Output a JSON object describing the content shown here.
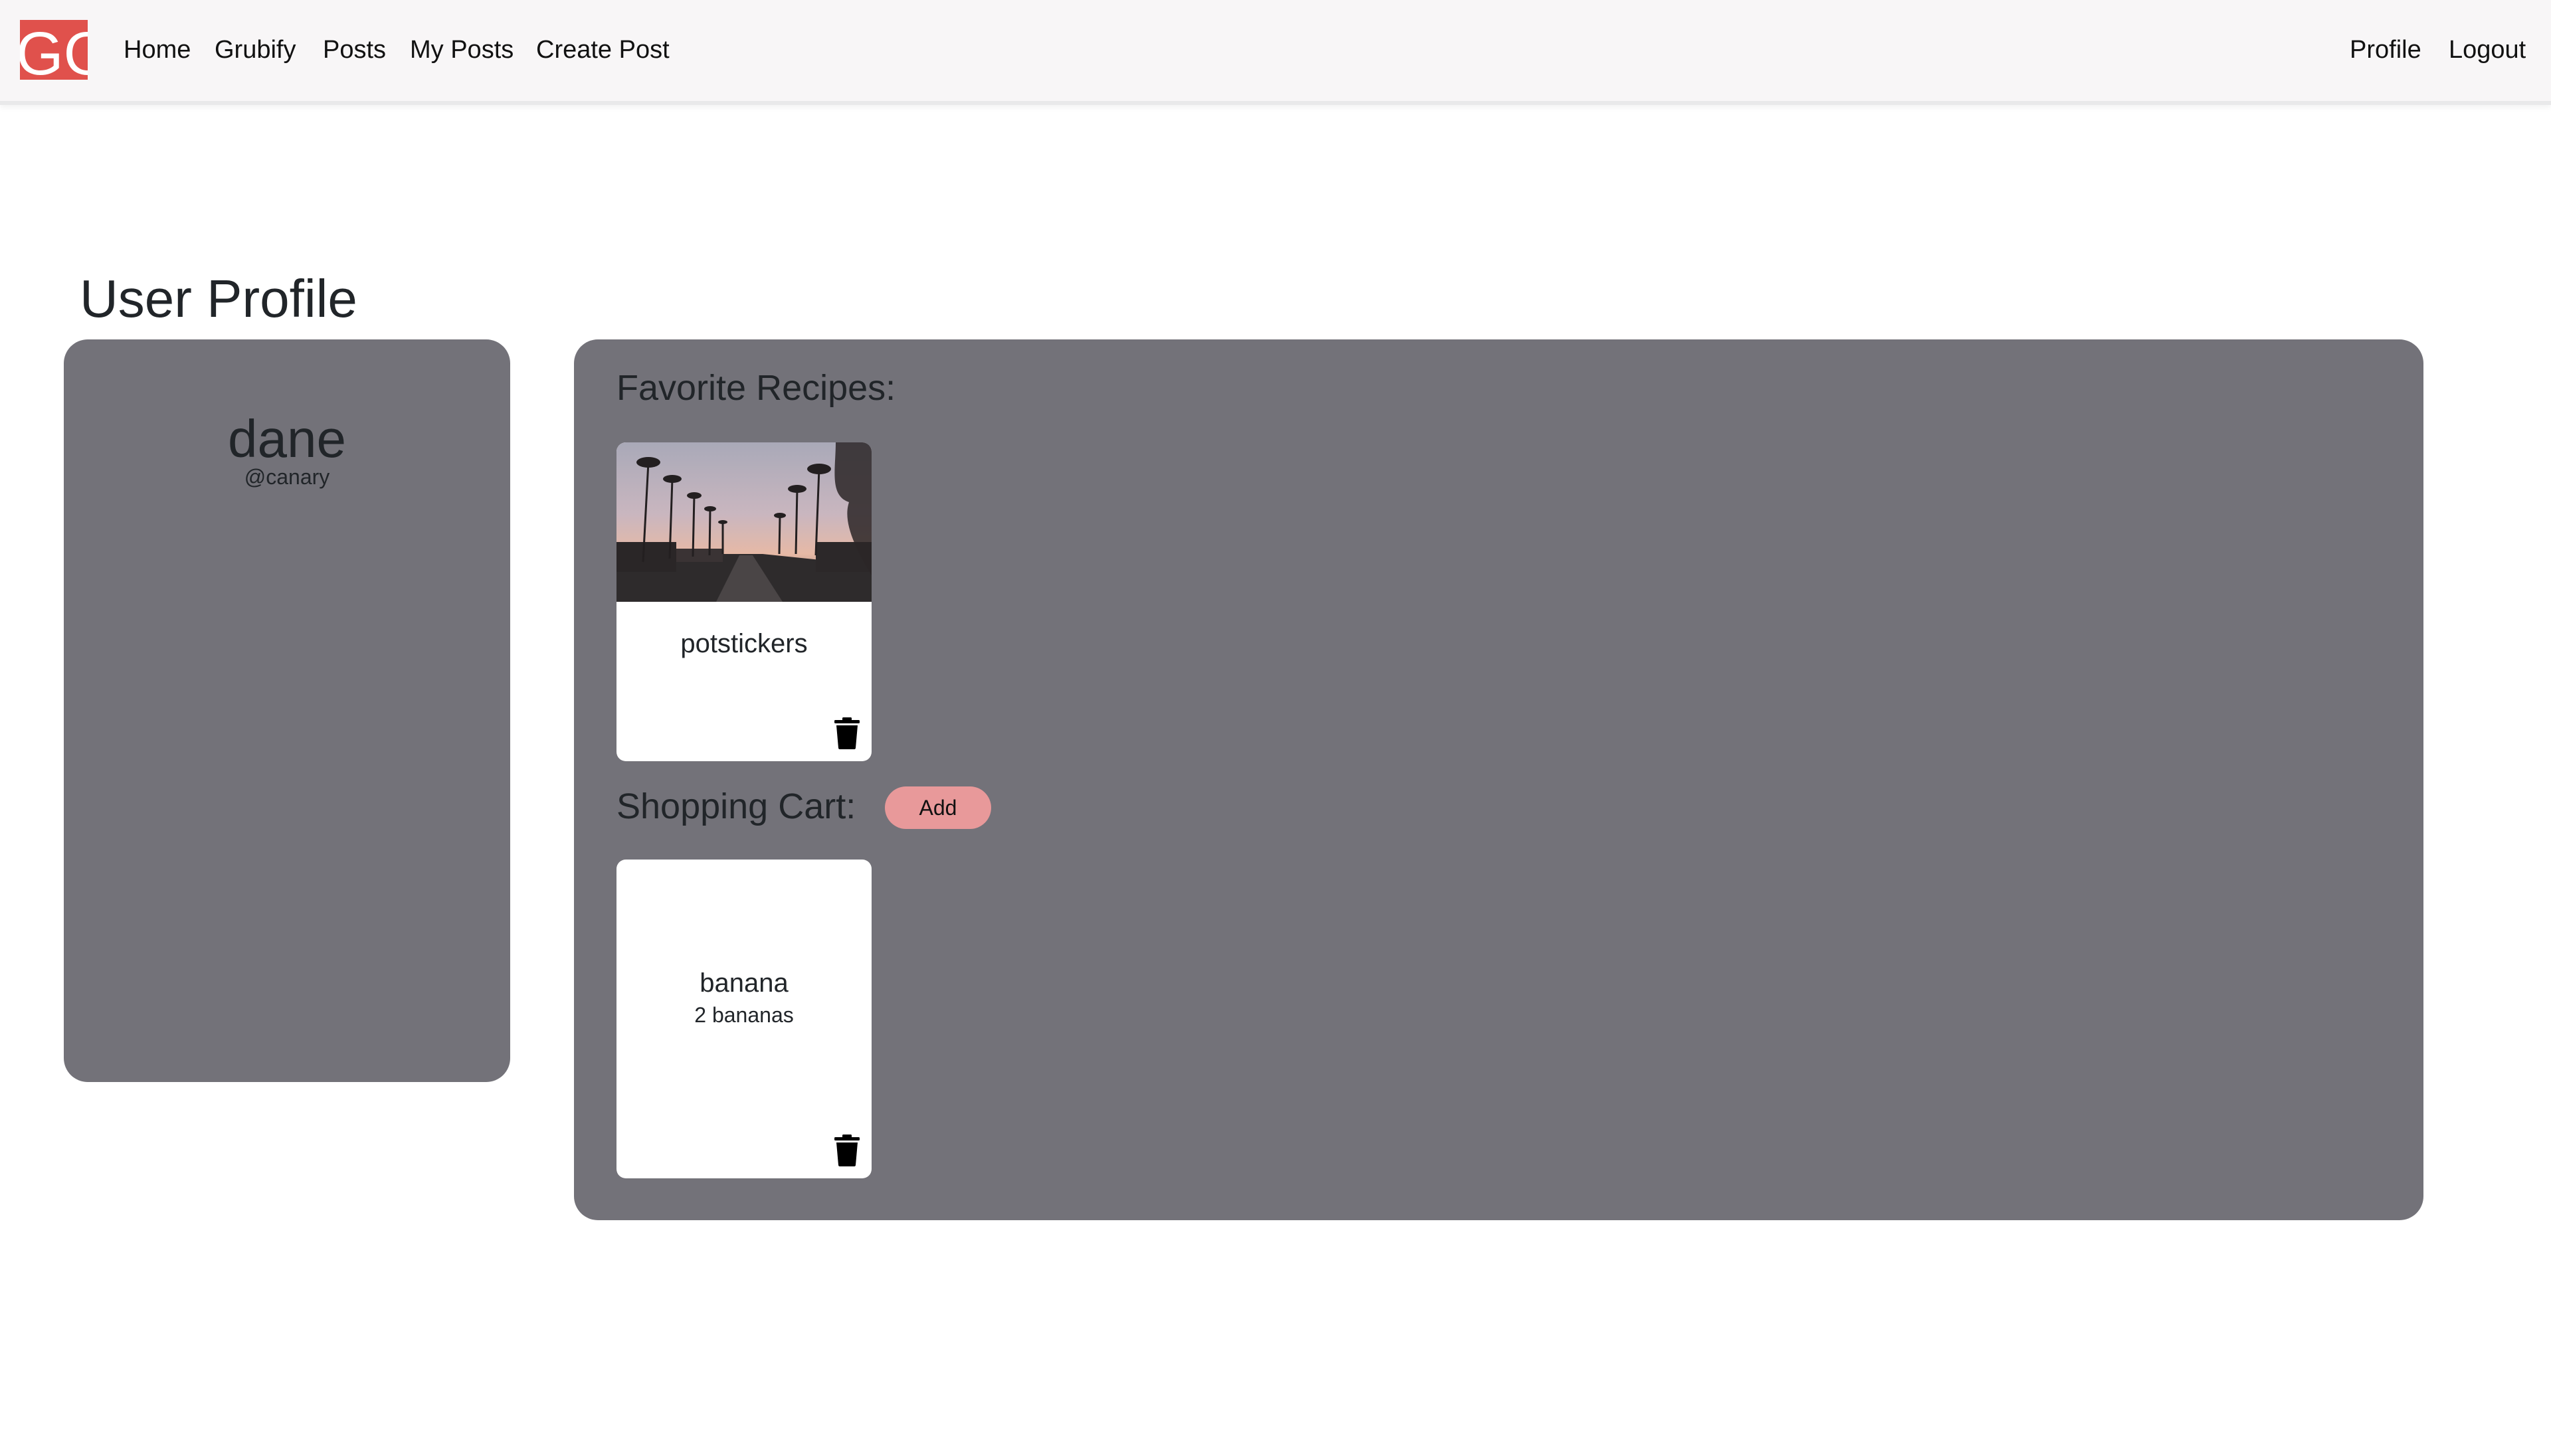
{
  "navbar": {
    "logo_text": "GG",
    "logo_color": "#e0514c",
    "links": [
      {
        "label": "Home"
      },
      {
        "label": "Grubify"
      },
      {
        "label": "Posts"
      },
      {
        "label": "My Posts"
      },
      {
        "label": "Create Post"
      }
    ],
    "right_links": [
      {
        "label": "Profile"
      },
      {
        "label": "Logout"
      }
    ]
  },
  "page": {
    "title": "User Profile"
  },
  "profile": {
    "name": "dane",
    "handle": "@canary"
  },
  "favorites": {
    "heading": "Favorite Recipes:",
    "items": [
      {
        "title": "potstickers",
        "image": "street-with-palm-trees-photo",
        "icon": "trash-icon"
      }
    ]
  },
  "cart": {
    "heading": "Shopping Cart:",
    "add_label": "Add",
    "items": [
      {
        "title": "banana",
        "quantity": "2 bananas",
        "icon": "trash-icon"
      }
    ]
  },
  "colors": {
    "panel": "#737279",
    "accent": "#e8999a",
    "navbar": "#f8f6f7"
  }
}
